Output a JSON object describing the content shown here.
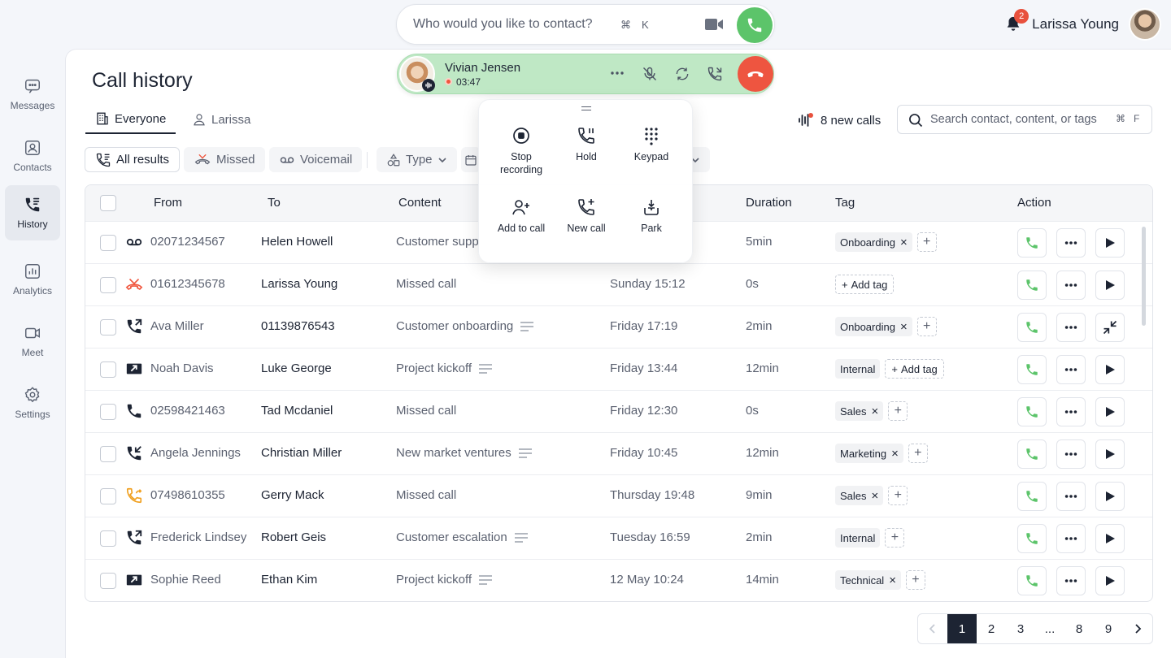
{
  "sidebar": {
    "items": [
      {
        "label": "Messages",
        "icon": "chat-icon"
      },
      {
        "label": "Contacts",
        "icon": "contact-card-icon"
      },
      {
        "label": "History",
        "icon": "phone-history-icon",
        "active": true
      },
      {
        "label": "Analytics",
        "icon": "analytics-icon"
      },
      {
        "label": "Meet",
        "icon": "video-icon"
      },
      {
        "label": "Settings",
        "icon": "gear-icon"
      }
    ]
  },
  "topbar": {
    "search_placeholder": "Who would you like to contact?",
    "shortcut_mod": "⌘",
    "shortcut_key": "K",
    "notifications": "2",
    "user_name": "Larissa Young"
  },
  "active_call": {
    "name": "Vivian Jensen",
    "duration": "03:47"
  },
  "call_menu": {
    "items": [
      "Stop recording",
      "Hold",
      "Keypad",
      "Add to call",
      "New call",
      "Park"
    ]
  },
  "page": {
    "title": "Call history",
    "tabs": [
      "Everyone",
      "Larissa"
    ],
    "new_calls": "8 new calls",
    "search_placeholder": "Search contact, content, or tags",
    "search_mod": "⌘",
    "search_key": "F"
  },
  "filters": [
    "All results",
    "Missed",
    "Voicemail",
    "Type"
  ],
  "table": {
    "columns": [
      "From",
      "To",
      "Content",
      "Duration",
      "Tag",
      "Action"
    ],
    "rows": [
      {
        "type": "voicemail",
        "from": "02071234567",
        "to": "Helen Howell",
        "content": "Customer supp",
        "date": "",
        "duration": "5min",
        "tags": [
          "Onboarding"
        ],
        "add": "plus",
        "action3": "play"
      },
      {
        "type": "missed",
        "from": "01612345678",
        "to": "Larissa Young",
        "content": "Missed call",
        "date": "Sunday  15:12",
        "duration": "0s",
        "tags": [],
        "add": "addtag",
        "action3": "play"
      },
      {
        "type": "outgoing",
        "from": "Ava Miller",
        "to": "01139876543",
        "content": "Customer onboarding",
        "date": "Friday  17:19",
        "duration": "2min",
        "tags": [
          "Onboarding"
        ],
        "add": "plus",
        "action3": "collapse"
      },
      {
        "type": "video",
        "from": "Noah Davis",
        "to": "Luke George",
        "content": "Project kickoff",
        "date": "Friday  13:44",
        "duration": "12min",
        "tags": [
          "Internal"
        ],
        "add": "addtag",
        "action3": "play"
      },
      {
        "type": "phone",
        "from": "02598421463",
        "to": "Tad Mcdaniel",
        "content": "Missed call",
        "date": "Friday  12:30",
        "duration": "0s",
        "tags": [
          "Sales"
        ],
        "add": "plus",
        "action3": "play"
      },
      {
        "type": "incoming",
        "from": "Angela Jennings",
        "to": "Christian Miller",
        "content": "New market ventures",
        "date": "Friday  10:45",
        "duration": "12min",
        "tags": [
          "Marketing"
        ],
        "add": "plus",
        "action3": "play"
      },
      {
        "type": "callback",
        "from": "07498610355",
        "to": "Gerry Mack",
        "content": "Missed call",
        "date": "Thursday  19:48",
        "duration": "9min",
        "tags": [
          "Sales"
        ],
        "add": "plus",
        "action3": "play"
      },
      {
        "type": "outgoing",
        "from": "Frederick Lindsey",
        "to": "Robert Geis",
        "content": "Customer escalation",
        "date": "Tuesday  16:59",
        "duration": "2min",
        "tags": [
          "Internal"
        ],
        "add": "plus",
        "action3": "play",
        "tag_noclose": true
      },
      {
        "type": "video",
        "from": "Sophie Reed",
        "to": "Ethan Kim",
        "content": "Project kickoff",
        "date": "12 May  10:24",
        "duration": "14min",
        "tags": [
          "Technical"
        ],
        "add": "plus",
        "action3": "play"
      }
    ],
    "add_tag_label": "Add tag"
  },
  "pagination": [
    "1",
    "2",
    "3",
    "...",
    "8",
    "9"
  ],
  "colors": {
    "accent_green": "#5cc46a",
    "hangup_red": "#ee5540",
    "badge_red": "#e8513d",
    "missed_orange": "#f0553d"
  }
}
